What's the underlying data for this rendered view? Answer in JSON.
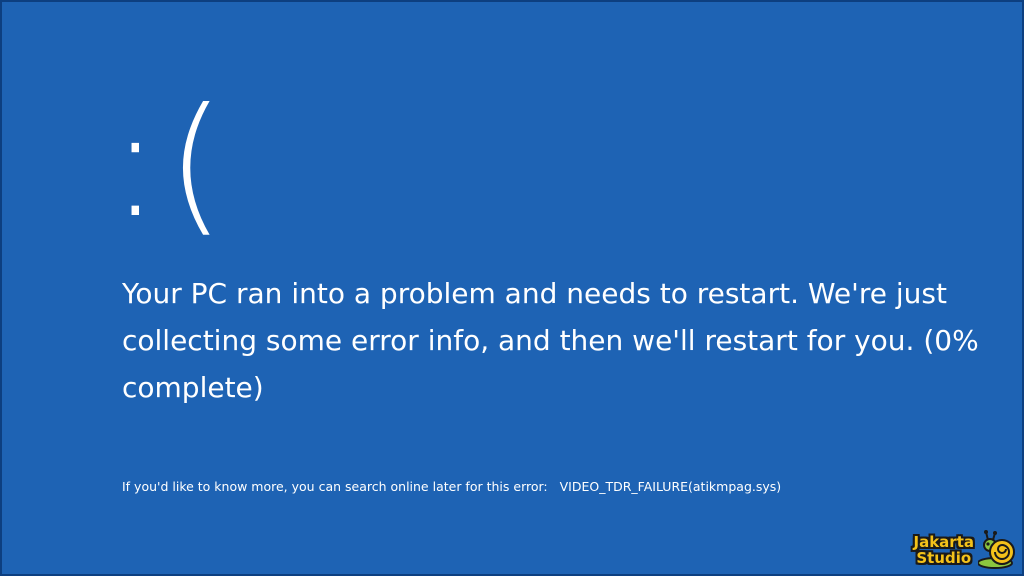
{
  "bsod": {
    "sad_face": ":(",
    "message": "Your PC ran into a problem and needs to restart. We're just collecting some error info, and then we'll restart for you. (0% complete)",
    "progress_percent": 0,
    "more_info": "If you'd like to know more, you can search online later for this error:",
    "stop_code": "VIDEO_TDR_FAILURE(atikmpag.sys)",
    "background_color": "#1e63b4"
  },
  "watermark": {
    "line1": "Jakarta",
    "line2": "Studio",
    "logo_icon": "snail-icon",
    "text_color": "#f4c21a"
  }
}
